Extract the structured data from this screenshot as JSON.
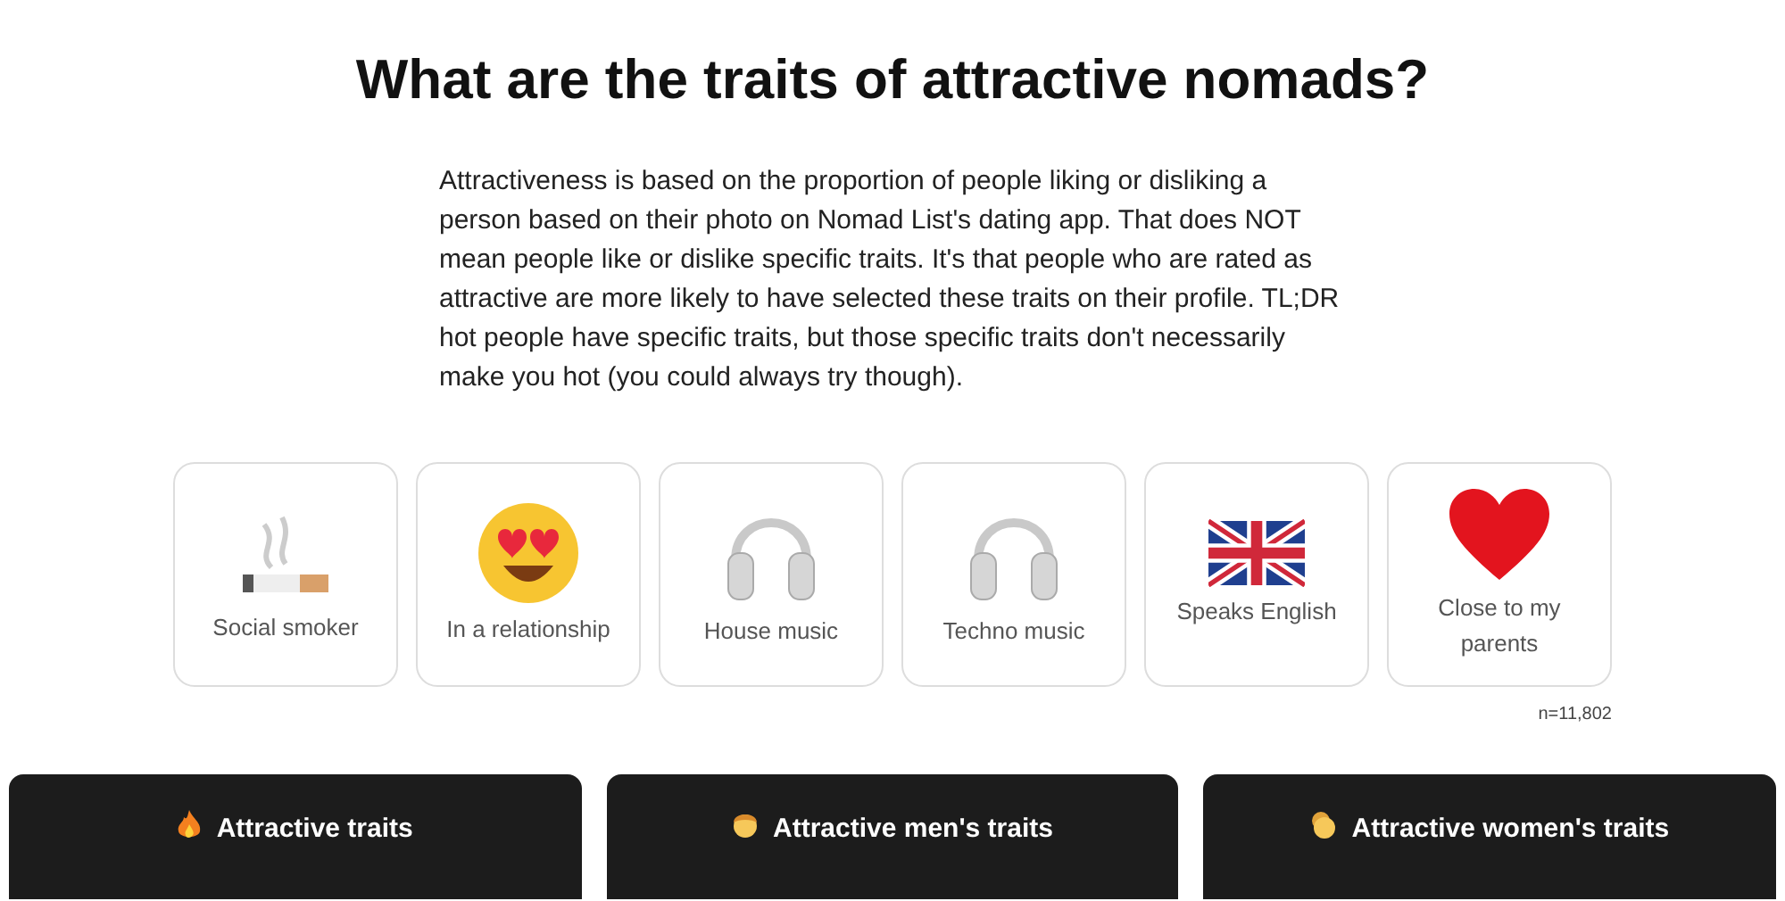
{
  "title": "What are the traits of attractive nomads?",
  "description": "Attractiveness is based on the proportion of people liking or disliking a person based on their photo on Nomad List's dating app. That does NOT mean people like or dislike specific traits. It's that people who are rated as attractive are more likely to have selected these traits on their profile. TL;DR hot people have specific traits, but those specific traits don't necessarily make you hot (you could always try though).",
  "traits": [
    {
      "kind": "cigarette",
      "label": "Social smoker"
    },
    {
      "kind": "heart-eyes",
      "label": "In a relationship"
    },
    {
      "kind": "headphones",
      "label": "House music"
    },
    {
      "kind": "headphones",
      "label": "Techno music"
    },
    {
      "kind": "flag",
      "label": "Speaks English"
    },
    {
      "kind": "heart",
      "label": "Close to my parents"
    }
  ],
  "sample_size": "n=11,802",
  "sections": [
    {
      "kind": "fire",
      "label": "Attractive traits"
    },
    {
      "kind": "man",
      "label": "Attractive men's traits"
    },
    {
      "kind": "woman",
      "label": "Attractive women's traits"
    }
  ]
}
